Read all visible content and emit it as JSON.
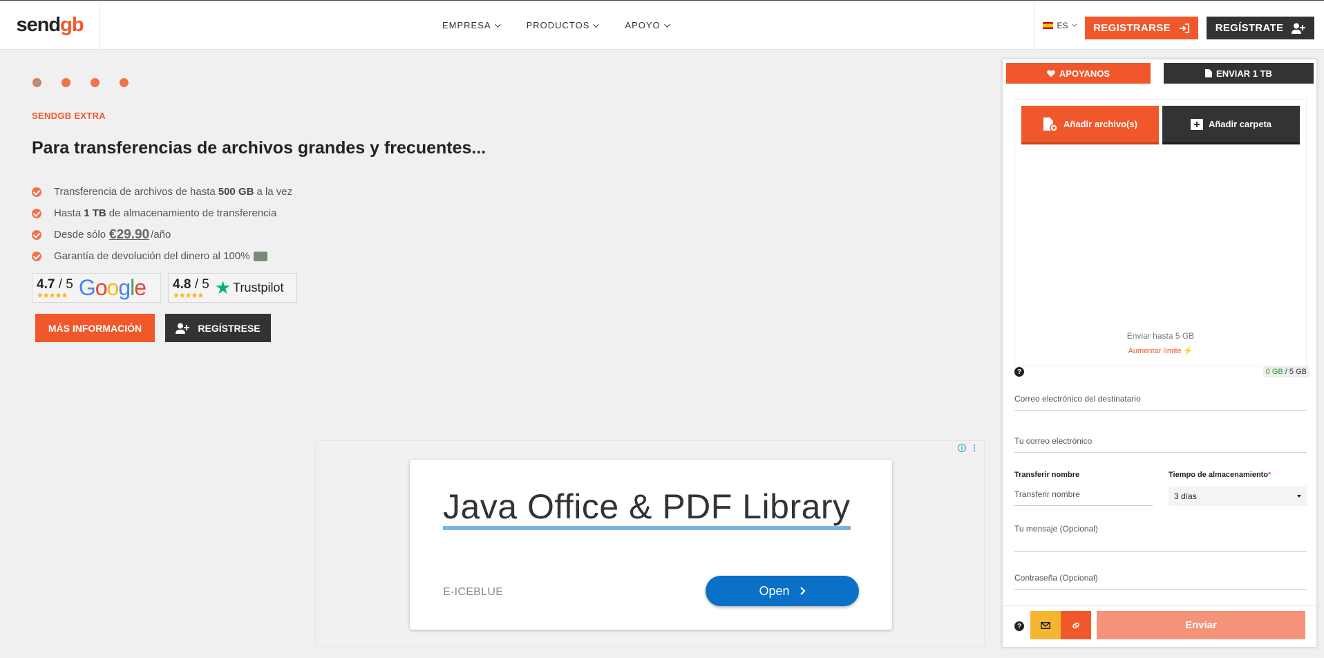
{
  "header": {
    "logo_text_main": "send",
    "logo_text_accent": "gb",
    "nav": [
      {
        "label": "EMPRESA"
      },
      {
        "label": "PRODUCTOS"
      },
      {
        "label": "APOYO"
      }
    ],
    "language": "ES",
    "register_orange_label": "REGISTRARSE",
    "register_dark_label": "REGÍSTRATE"
  },
  "hero": {
    "kicker": "SENDGB EXTRA",
    "headline": "Para transferencias de archivos grandes y frecuentes...",
    "features": [
      {
        "pre": "Transferencia de archivos de hasta",
        "bold": "500 GB",
        "post": "a la vez"
      },
      {
        "pre": "Hasta",
        "bold": "1 TB",
        "post": "de almacenamiento de transferencia"
      },
      {
        "pre": "Desde sólo",
        "price": "€29.90",
        "post": "/año"
      },
      {
        "pre": "Garantía de devolución del dinero al 100%"
      }
    ],
    "google_rating": {
      "score": "4.7",
      "out_of": "/ 5",
      "stars": "★★★★★",
      "brand": "Google"
    },
    "trustpilot_rating": {
      "score": "4.8",
      "out_of": "/ 5",
      "stars": "★★★★★",
      "brand": "Trustpilot"
    },
    "more_info_label": "MÁS INFORMACIÓN",
    "register_label": "REGÍSTRESE"
  },
  "ad": {
    "title": "Java Office & PDF Library",
    "brand": "E-ICEBLUE",
    "cta": "Open"
  },
  "upload_panel": {
    "support_label": "APOYANOS",
    "send_1tb_label": "ENVIAR 1 TB",
    "add_files_label": "Añadir archivo(s)",
    "add_folder_label": "Añadir carpeta",
    "send_limit_text": "Enviar hasta 5 GB",
    "raise_limit_text": "Aumentar límite",
    "usage_used": "0 GB",
    "usage_total": " / 5 GB",
    "recipient_email_placeholder": "Correo electrónico del destinatario",
    "your_email_placeholder": "Tu correo electrónico",
    "transfer_name_label": "Transferir nombre",
    "transfer_name_placeholder": "Transferir nombre",
    "storage_time_label": "Tiempo de almacenamiento",
    "storage_time_value": "3 días",
    "message_placeholder": "Tu mensaje  (Opcional)",
    "password_placeholder": "Contraseña (Opcional)",
    "send_label": "Enviar"
  },
  "colors": {
    "accent": "#f0582b",
    "dark": "#333333",
    "send_disabled": "#f4937a",
    "mail_button": "#f6b633"
  },
  "icons": [
    "chevron-down-icon",
    "sign-in-icon",
    "user-plus-icon",
    "check-circle-icon",
    "heart-icon",
    "file-icon",
    "file-add-icon",
    "folder-add-icon",
    "bolt-icon",
    "help-icon",
    "envelope-icon",
    "link-icon",
    "info-icon",
    "chevron-right-icon",
    "spain-flag-icon"
  ]
}
